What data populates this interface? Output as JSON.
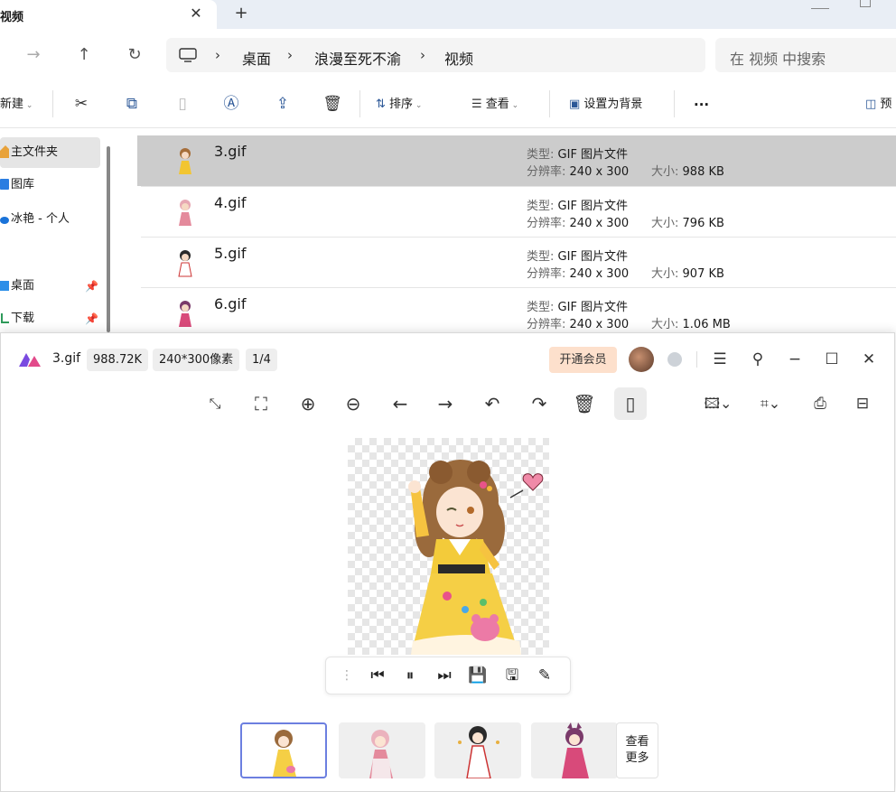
{
  "explorer": {
    "tab": {
      "title": "视频",
      "close": "✕",
      "new": "+"
    },
    "nav": {
      "back": "→",
      "up": "↑",
      "refresh": "↻"
    },
    "breadcrumb": [
      "桌面",
      "浪漫至死不渝",
      "视频"
    ],
    "breadcrumb_sep": "›",
    "search_placeholder": "在 视频 中搜索",
    "commands": {
      "new": "新建",
      "sort": "排序",
      "view": "查看",
      "set_background": "设置为背景",
      "more": "···",
      "details": "预"
    },
    "sidebar": [
      {
        "label": "主文件夹"
      },
      {
        "label": "图库"
      },
      {
        "label": "冰艳 - 个人"
      },
      {
        "label": "桌面"
      },
      {
        "label": "下载"
      }
    ],
    "files": [
      {
        "name": "3.gif",
        "type_label": "类型:",
        "type": "GIF 图片文件",
        "res_label": "分辨率:",
        "res": "240 x 300",
        "size_label": "大小:",
        "size": "988 KB"
      },
      {
        "name": "4.gif",
        "type_label": "类型:",
        "type": "GIF 图片文件",
        "res_label": "分辨率:",
        "res": "240 x 300",
        "size_label": "大小:",
        "size": "796 KB"
      },
      {
        "name": "5.gif",
        "type_label": "类型:",
        "type": "GIF 图片文件",
        "res_label": "分辨率:",
        "res": "240 x 300",
        "size_label": "大小:",
        "size": "907 KB"
      },
      {
        "name": "6.gif",
        "type_label": "类型:",
        "type": "GIF 图片文件",
        "res_label": "分辨率:",
        "res": "240 x 300",
        "size_label": "大小:",
        "size": "1.06 MB"
      }
    ]
  },
  "viewer": {
    "filename": "3.gif",
    "filesize": "988.72K",
    "dimensions": "240*300像素",
    "position": "1/4",
    "vip_label": "开通会员",
    "more_label_top": "查看",
    "more_label_bottom": "更多",
    "colors": {
      "vip_bg": "#fde0cc",
      "selection_border": "#6c7fe0",
      "logo": "#7a4ae0"
    }
  }
}
